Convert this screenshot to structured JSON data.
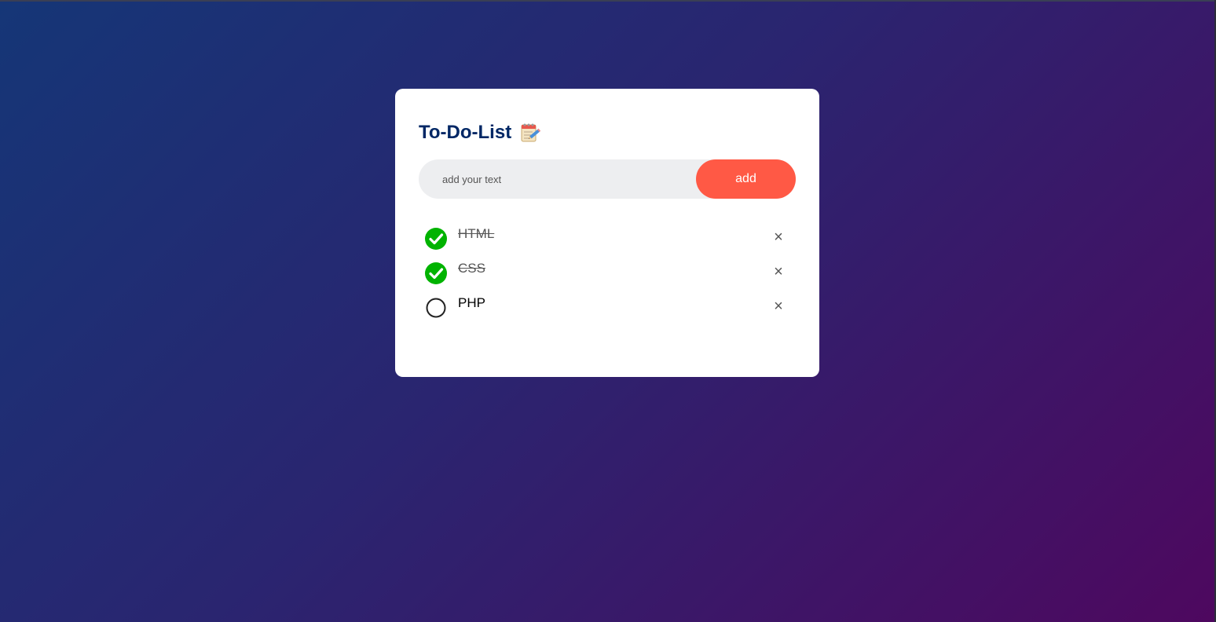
{
  "header": {
    "title": "To-Do-List",
    "title_icon": "notepad-icon"
  },
  "input": {
    "placeholder": "add your text",
    "value": ""
  },
  "add_button": {
    "label": "add"
  },
  "tasks": [
    {
      "label": "HTML",
      "checked": true
    },
    {
      "label": "CSS",
      "checked": true
    },
    {
      "label": "PHP",
      "checked": false
    }
  ],
  "icons": {
    "checked": "checked-circle-icon",
    "unchecked": "unchecked-circle-icon",
    "delete": "close-icon",
    "delete_glyph": "×"
  },
  "colors": {
    "background_start": "#153677",
    "background_end": "#4e085f",
    "title": "#002765",
    "accent": "#ff5945",
    "check_green": "#00b300",
    "input_bg": "#edeef0"
  }
}
